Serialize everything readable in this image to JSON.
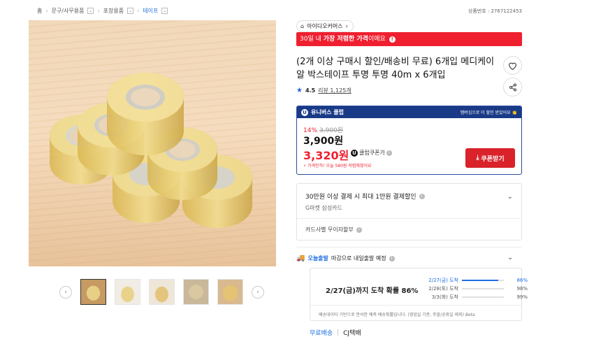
{
  "breadcrumb": {
    "items": [
      "홈",
      "문구/사무용품",
      "포장용품",
      "테이프"
    ]
  },
  "product_no": "상품번호 : 2767122453",
  "store": {
    "name": "아이디오커머스"
  },
  "banner": {
    "pre": "30일 내 ",
    "bold": "가장 저렴한 가격",
    "post": "이에요"
  },
  "title": "(2개 이상 구매시 할인/배송비 무료) 6개입 메디케이알 박스테이프 투명 투명 40m x 6개입",
  "rating": {
    "score": "4.5",
    "reviews": "리뷰 1,125개"
  },
  "club": {
    "header": "유니버스 클럽",
    "header_right": "멤버십으로 더 할인 받았어요 👏",
    "discount_pct": "14%",
    "original_price": "3,900원",
    "price": "3,900원",
    "club_price": "3,320원",
    "club_label": "클럽쿠폰가",
    "note": "가격인하! 오늘 580원 저렴해졌어요",
    "coupon_button": "쿠폰받기"
  },
  "card": {
    "line1": "30만원 이상 결제 시 최대 1만원 결제할인",
    "line2": "G마켓 삼성카드",
    "line3": "카드사별 무이자할부"
  },
  "today": {
    "tag": "오늘출발",
    "text": "마감으로 내일출발 예정"
  },
  "delivery": {
    "main": "2/27(금)까지 도착 확률 86%",
    "rows": [
      {
        "date": "2/27(금) 도착",
        "pct": "86%",
        "value": 86
      },
      {
        "date": "2/28(토) 도착",
        "pct": "98%",
        "value": 98
      },
      {
        "date": "3/3(화) 도착",
        "pct": "99%",
        "value": 99
      }
    ],
    "footnote": "배송데이터 기반으로 분석한 예측 배송확률입니다. (영업일 기준, 주말/공휴일 제외)",
    "beta": "Beta"
  },
  "shipping": {
    "free": "무료배송",
    "carrier": "CJ택배"
  }
}
